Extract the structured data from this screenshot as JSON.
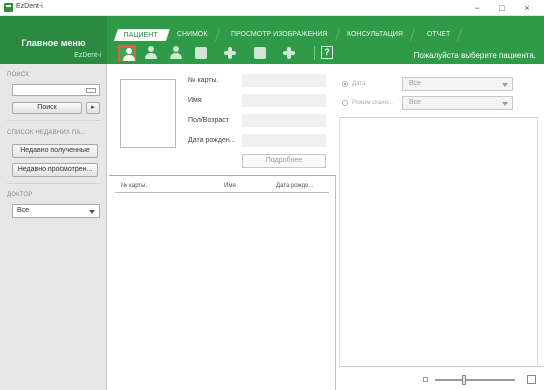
{
  "window": {
    "title": "EzDent-i",
    "minimize": "−",
    "maximize": "□",
    "close": "×"
  },
  "menu": {
    "title": "Главное меню",
    "subtitle": "EzDent-i"
  },
  "tabs": [
    {
      "label": "ПАЦИЕНТ",
      "active": true
    },
    {
      "label": "СНИМОК",
      "active": false
    },
    {
      "label": "ПРОСМОТР ИЗОБРАЖЕНИЯ",
      "active": false
    },
    {
      "label": "КОНСУЛЬТАЦИЯ",
      "active": false
    },
    {
      "label": "ОТЧЕТ",
      "active": false
    }
  ],
  "toolbar": {
    "help_label": "?",
    "hint": "Пожалуйста выберите пациента."
  },
  "sidebar": {
    "search_header": "ПОИСК",
    "search_value": "",
    "search_button": "Поиск",
    "search_arrow": "▸",
    "recent_header": "СПИСОК НЕДАВНИХ ПА...",
    "recent_received": "Недавно полученные",
    "recent_viewed": "Недавно просмотрен...",
    "doctor_header": "ДОКТОР",
    "doctor_value": "Все"
  },
  "patient": {
    "card_label": "№ карты.",
    "name_label": "Имя",
    "sex_age_label": "Пол/Возраст",
    "birth_label": "Дата рожден...",
    "more_button": "Подробнее"
  },
  "list": {
    "columns": [
      "№ карты.",
      "Имя",
      "Дата рожде..."
    ]
  },
  "filters": {
    "date_label": "Дата",
    "date_value": "Все",
    "mode_label": "Режим скани...",
    "mode_value": "Все"
  },
  "colors": {
    "header_green": "#2f9a47",
    "menu_green": "#2a8a40",
    "selected_tool_border": "#e0613b"
  }
}
